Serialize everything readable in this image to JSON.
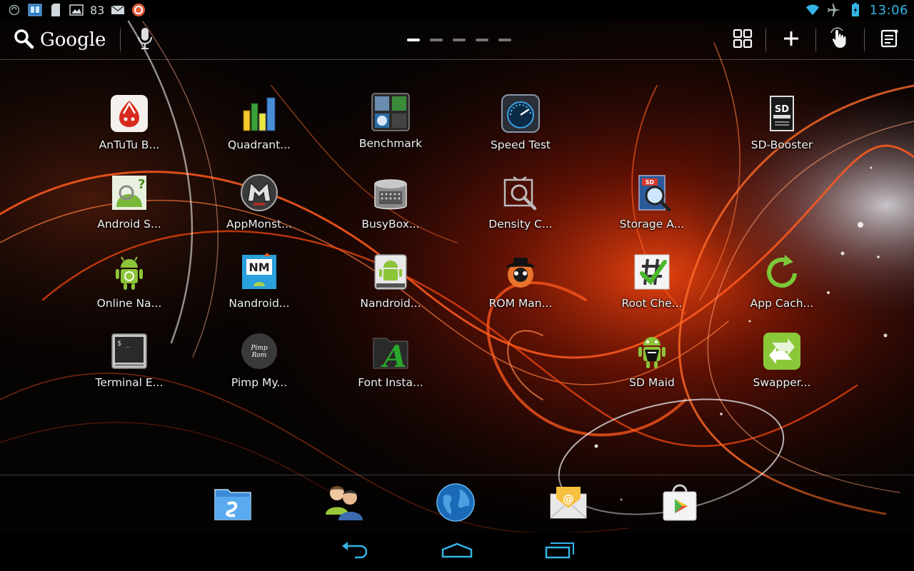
{
  "status_bar": {
    "icons_left": [
      "sync-icon",
      "ebook-icon",
      "sd-card-icon",
      "gallery-icon"
    ],
    "notification_count": "83",
    "icons_left_after": [
      "mail-icon",
      "app-notification-icon"
    ],
    "icons_right": [
      "wifi-icon",
      "airplane-icon",
      "battery-icon"
    ],
    "clock": "13:06",
    "colors": {
      "accent": "#33b5e5"
    }
  },
  "top_bar": {
    "search_label": "Google",
    "page_count": 5,
    "active_page": 0,
    "actions": [
      "all-apps-icon",
      "add-icon",
      "gesture-icon",
      "menu-icon"
    ]
  },
  "apps": [
    {
      "label": "AnTuTu B...",
      "icon": "antutu-icon"
    },
    {
      "label": "Quadrant...",
      "icon": "quadrant-icon"
    },
    {
      "label": "Benchmark",
      "icon": "benchmark-folder-icon"
    },
    {
      "label": "Speed Test",
      "icon": "speed-test-icon"
    },
    {
      "label": "SD-Booster",
      "icon": "sd-booster-icon"
    },
    {
      "label": "Android S...",
      "icon": "android-system-info-icon"
    },
    {
      "label": "AppMonst...",
      "icon": "appmonster-icon"
    },
    {
      "label": "BusyBox...",
      "icon": "busybox-icon"
    },
    {
      "label": "Density C...",
      "icon": "density-changer-icon"
    },
    {
      "label": "Storage A...",
      "icon": "storage-analyser-icon"
    },
    {
      "label": "Online Na...",
      "icon": "online-nandroid-icon"
    },
    {
      "label": "Nandroid...",
      "icon": "nandroid-manager-icon"
    },
    {
      "label": "Nandroid...",
      "icon": "nandroid-browser-icon"
    },
    {
      "label": "ROM Man...",
      "icon": "rom-manager-icon"
    },
    {
      "label": "Root Che...",
      "icon": "root-checker-icon"
    },
    {
      "label": "App Cach...",
      "icon": "app-cache-cleaner-icon"
    },
    {
      "label": "Terminal E...",
      "icon": "terminal-emulator-icon"
    },
    {
      "label": "Pimp My...",
      "icon": "pimp-my-rom-icon"
    },
    {
      "label": "Font Insta...",
      "icon": "font-installer-icon"
    },
    {
      "label": "SD Maid",
      "icon": "sd-maid-icon"
    },
    {
      "label": "Swapper...",
      "icon": "swapper-icon"
    }
  ],
  "dock": [
    "file-manager-icon",
    "contacts-icon",
    "browser-icon",
    "email-icon",
    "play-store-icon"
  ],
  "nav_bar": [
    "back-icon",
    "home-icon",
    "recent-apps-icon"
  ]
}
